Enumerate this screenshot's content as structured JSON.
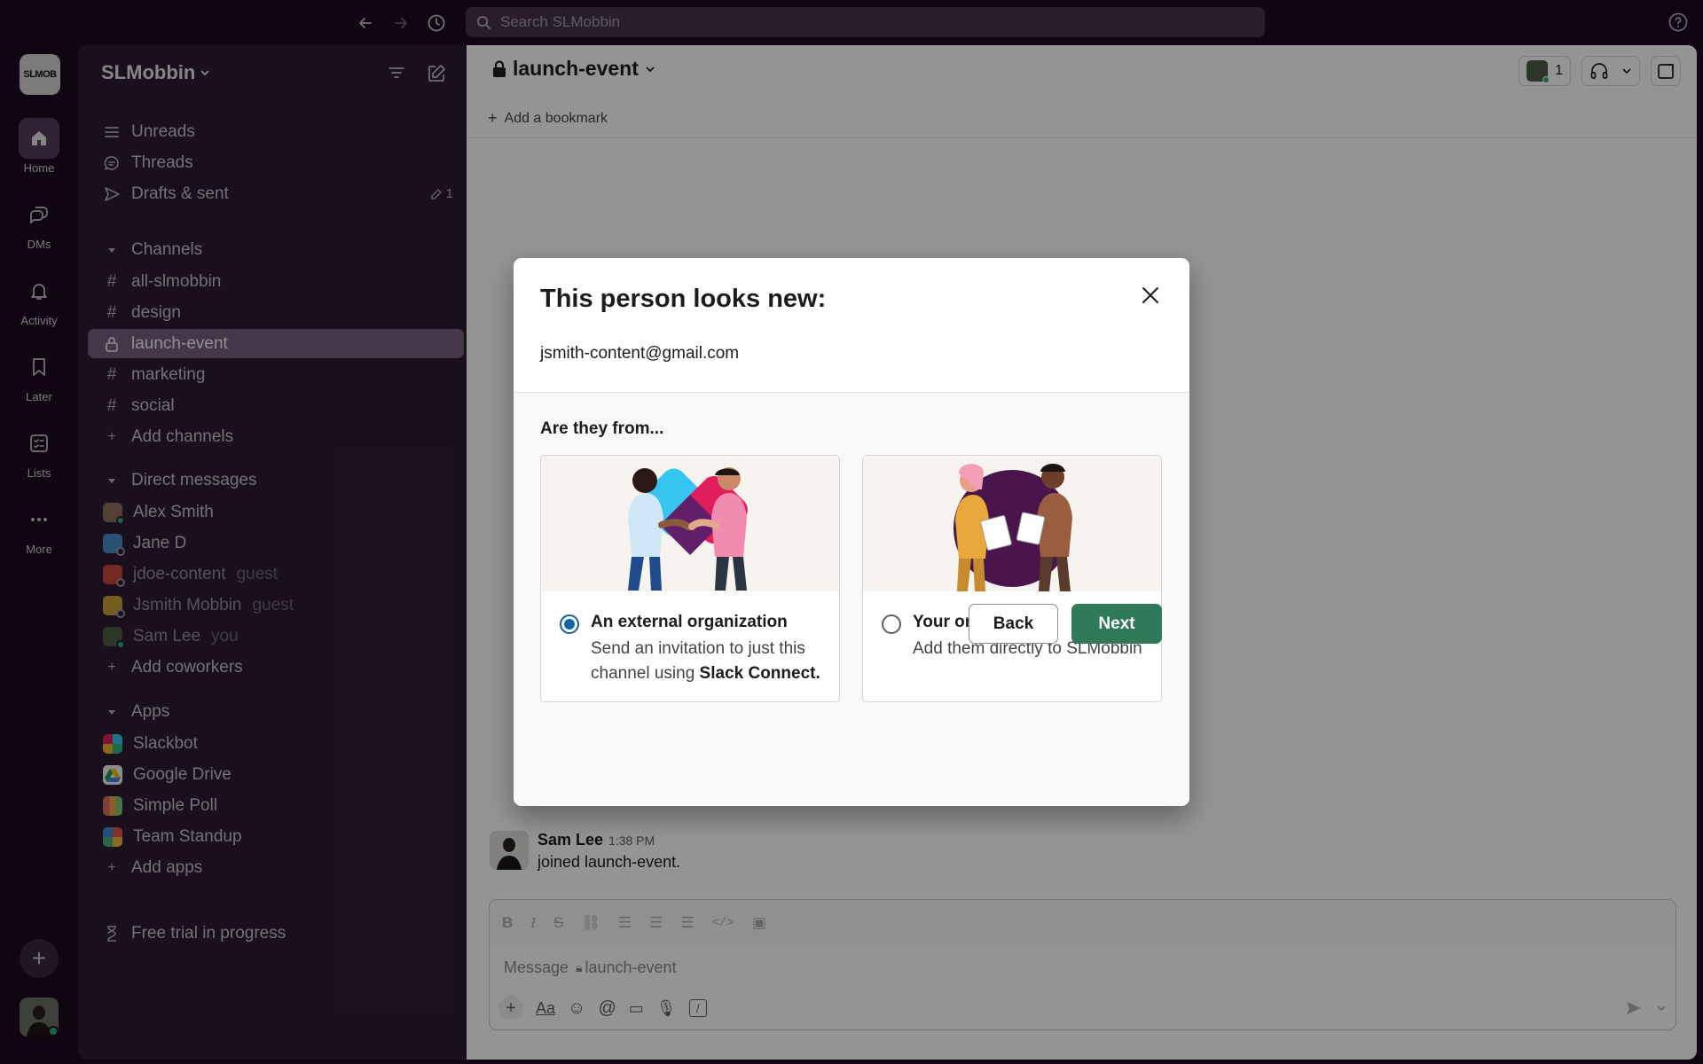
{
  "topbar": {
    "search_placeholder": "Search SLMobbin"
  },
  "rail": {
    "workspace_logo_text": "SLMOB",
    "items": [
      {
        "label": "Home"
      },
      {
        "label": "DMs"
      },
      {
        "label": "Activity"
      },
      {
        "label": "Later"
      },
      {
        "label": "Lists"
      },
      {
        "label": "More"
      }
    ]
  },
  "sidebar": {
    "workspace_name": "SLMobbin",
    "nav": [
      {
        "label": "Unreads"
      },
      {
        "label": "Threads"
      },
      {
        "label": "Drafts & sent",
        "count": "1"
      }
    ],
    "channels_header": "Channels",
    "channels": [
      {
        "label": "all-slmobbin"
      },
      {
        "label": "design"
      },
      {
        "label": "launch-event"
      },
      {
        "label": "marketing"
      },
      {
        "label": "social"
      }
    ],
    "add_channels": "Add channels",
    "dm_header": "Direct messages",
    "dms": [
      {
        "name": "Alex Smith",
        "tag": ""
      },
      {
        "name": "Jane D",
        "tag": ""
      },
      {
        "name": "jdoe-content",
        "tag": "guest"
      },
      {
        "name": "Jsmith Mobbin",
        "tag": "guest"
      },
      {
        "name": "Sam Lee",
        "tag": "you"
      }
    ],
    "add_coworkers": "Add coworkers",
    "apps_header": "Apps",
    "apps": [
      {
        "name": "Slackbot"
      },
      {
        "name": "Google Drive"
      },
      {
        "name": "Simple Poll"
      },
      {
        "name": "Team Standup"
      }
    ],
    "add_apps": "Add apps",
    "trial": "Free trial in progress"
  },
  "channel": {
    "name": "launch-event",
    "member_count": "1",
    "add_bookmark": "Add a bookmark",
    "message": {
      "author": "Sam Lee",
      "time": "1:38 PM",
      "text": "joined launch-event."
    },
    "composer_placeholder": "Message",
    "composer_channel": "launch-event"
  },
  "modal": {
    "title": "This person looks new:",
    "email": "jsmith-content@gmail.com",
    "question": "Are they from...",
    "options": [
      {
        "title": "An external organization",
        "desc_prefix": "Send an invitation to just this channel using ",
        "desc_bold": "Slack Connect.",
        "selected": true
      },
      {
        "title": "Your organization",
        "desc_prefix": "Add them directly to SLMobbin",
        "desc_bold": "",
        "selected": false
      }
    ],
    "back_label": "Back",
    "next_label": "Next"
  },
  "colors": {
    "sidebar_bg": "#2e1c33",
    "rail_bg": "#1a0b1f",
    "active_item": "#785d7e",
    "primary_button": "#2f7a58",
    "radio_selected": "#1264a3"
  }
}
